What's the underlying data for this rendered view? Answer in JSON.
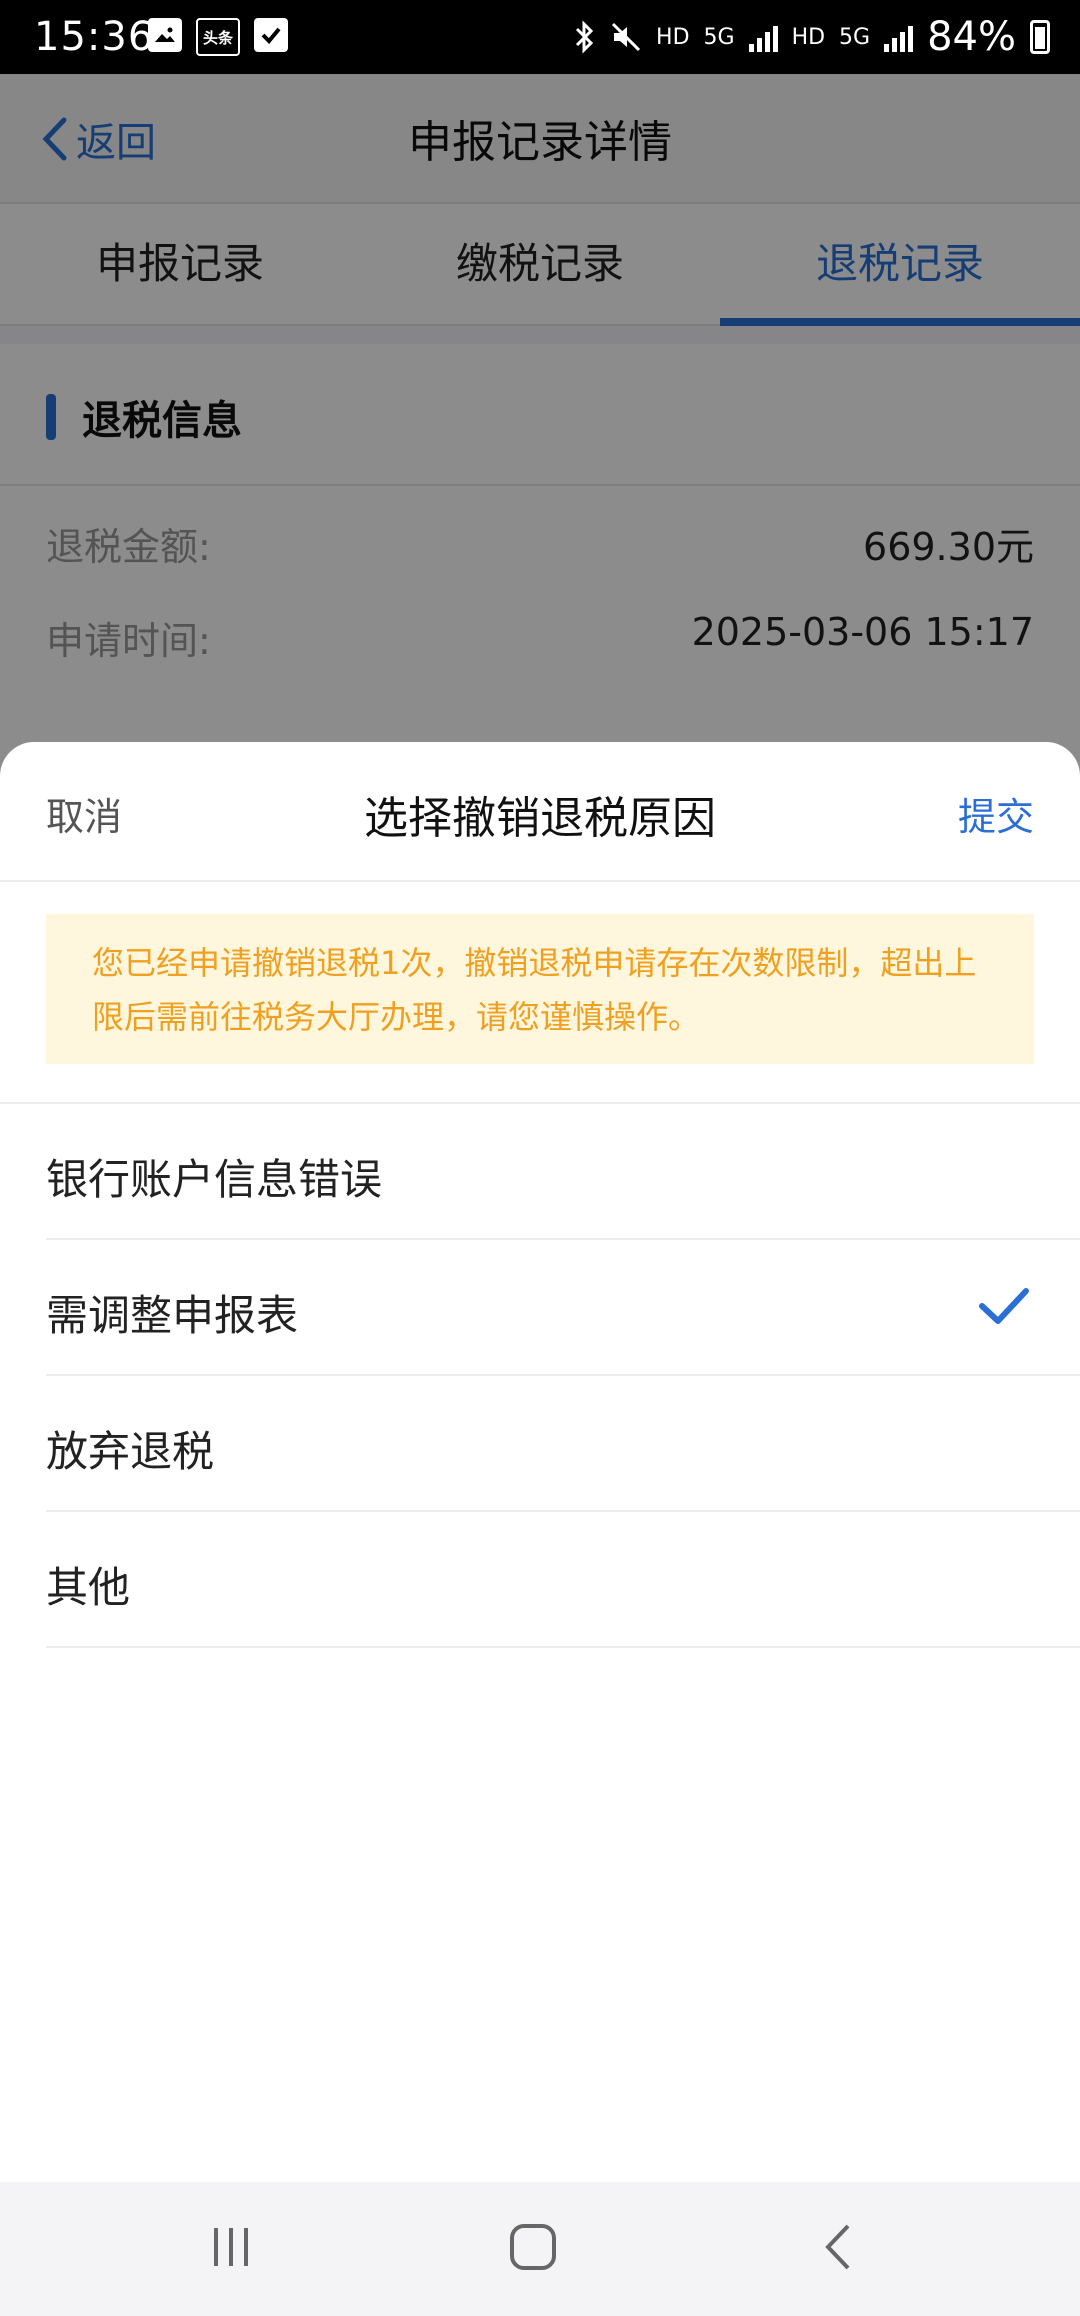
{
  "status_bar": {
    "time": "15:36",
    "left_icons": [
      "gallery-icon",
      "toutiao-icon",
      "check-icon"
    ],
    "toutiao_text": "头条",
    "hd1": "HD",
    "net1": "5G",
    "hd2": "HD",
    "net2": "5G",
    "battery": "84%"
  },
  "navbar": {
    "back_label": "返回",
    "title": "申报记录详情"
  },
  "tabs": [
    {
      "label": "申报记录",
      "active": false
    },
    {
      "label": "缴税记录",
      "active": false
    },
    {
      "label": "退税记录",
      "active": true
    }
  ],
  "refund_section": {
    "title": "退税信息",
    "rows": [
      {
        "label": "退税金额:",
        "value": "669.30元"
      },
      {
        "label": "申请时间:",
        "value": "2025-03-06 15:17"
      }
    ]
  },
  "sheet": {
    "cancel": "取消",
    "title": "选择撤销退税原因",
    "submit": "提交",
    "notice": "您已经申请撤销退税1次，撤销退税申请存在次数限制，超出上限后需前往税务大厅办理，请您谨慎操作。",
    "options": [
      {
        "label": "银行账户信息错误",
        "selected": false
      },
      {
        "label": "需调整申报表",
        "selected": true
      },
      {
        "label": "放弃退税",
        "selected": false
      },
      {
        "label": "其他",
        "selected": false
      }
    ]
  },
  "colors": {
    "accent": "#2b6fd6",
    "notice_text": "#f0a020",
    "notice_bg": "#fff7dd"
  },
  "system_nav": [
    "recent-apps-icon",
    "home-icon",
    "back-icon"
  ]
}
